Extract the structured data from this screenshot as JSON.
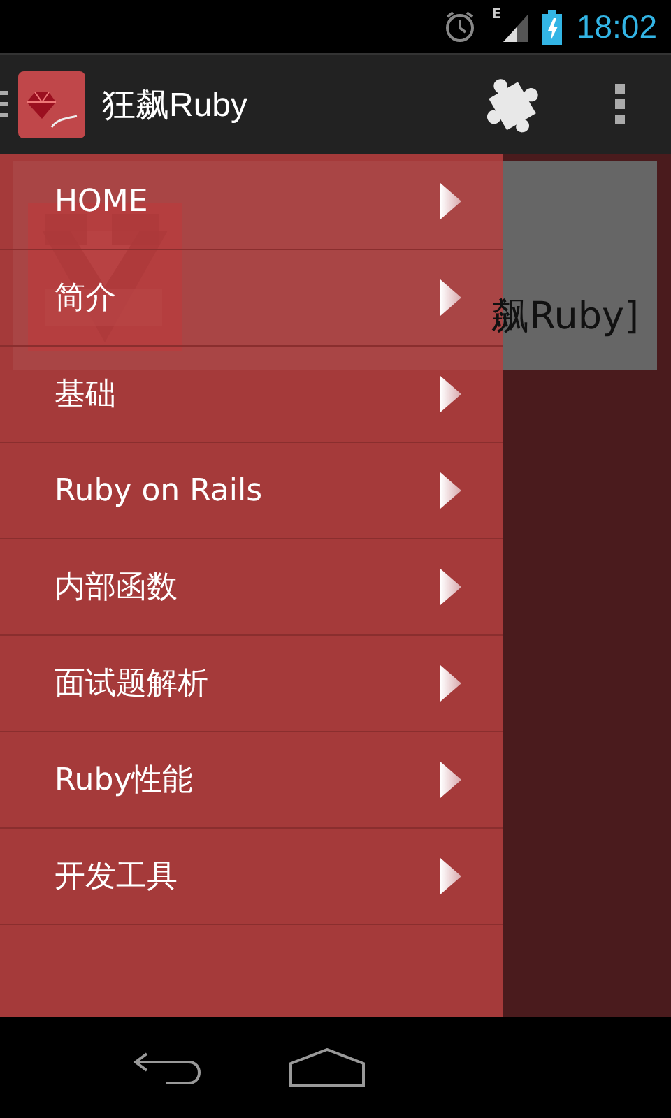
{
  "status_bar": {
    "network_type": "E",
    "time": "18:02"
  },
  "action_bar": {
    "title": "狂飙Ruby"
  },
  "content": {
    "message": "飙Ruby]"
  },
  "drawer": {
    "items": [
      {
        "label": "HOME"
      },
      {
        "label": "简介"
      },
      {
        "label": "基础"
      },
      {
        "label": "Ruby on Rails"
      },
      {
        "label": "内部函数"
      },
      {
        "label": "面试题解析"
      },
      {
        "label": "Ruby性能"
      },
      {
        "label": "开发工具"
      }
    ]
  }
}
